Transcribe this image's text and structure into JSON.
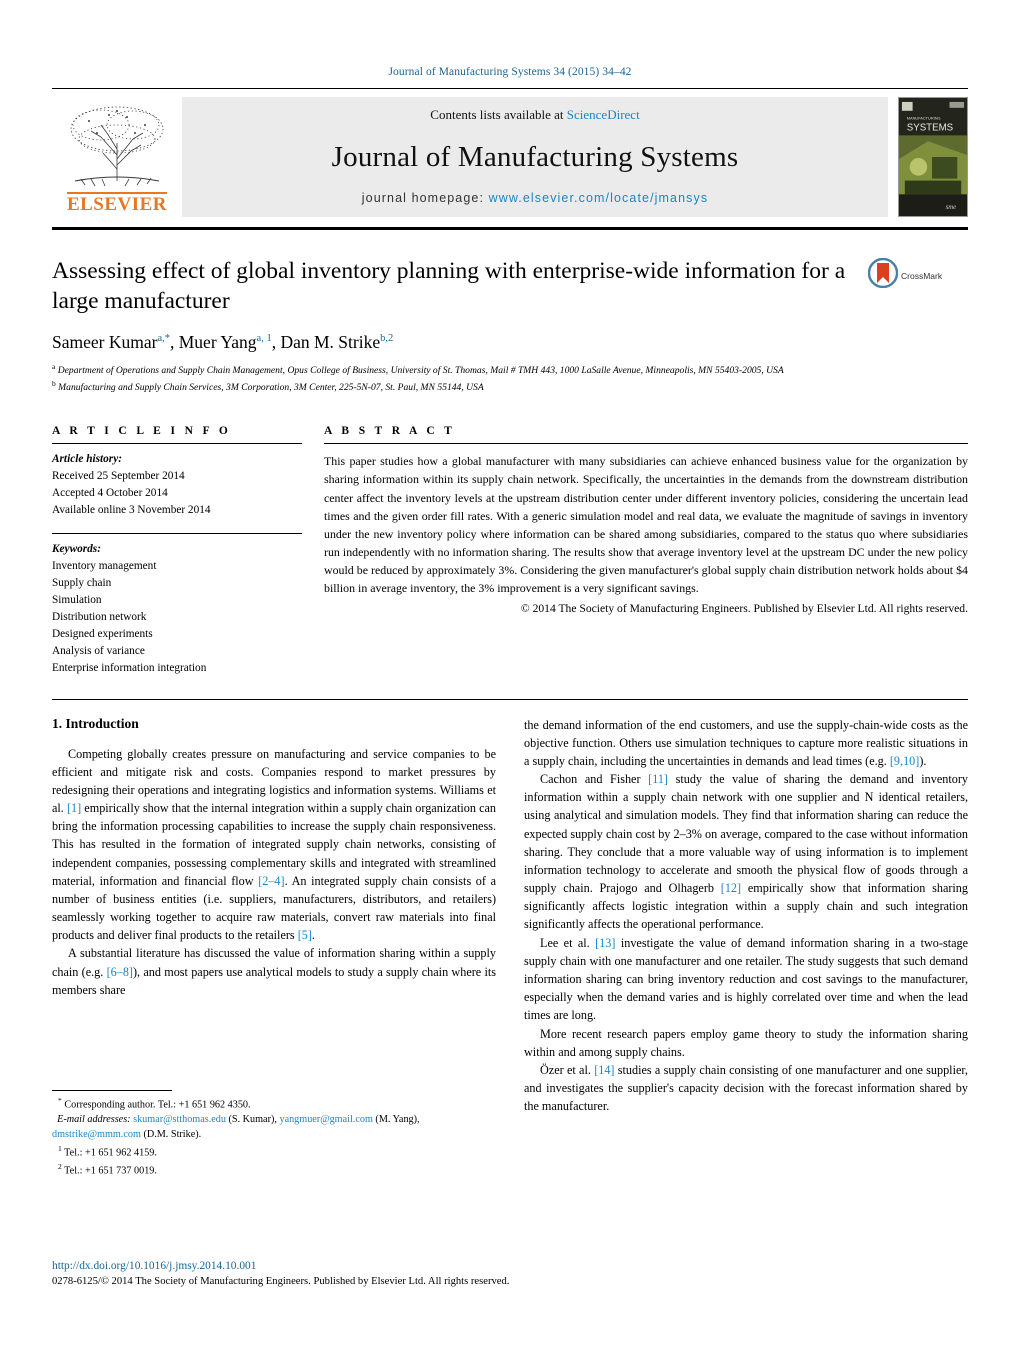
{
  "running_head": "Journal of Manufacturing Systems 34 (2015) 34–42",
  "masthead": {
    "contents_prefix": "Contents lists available at",
    "sciencedirect": "ScienceDirect",
    "journal_name": "Journal of Manufacturing Systems",
    "homepage_prefix": "journal homepage:",
    "homepage_url": "www.elsevier.com/locate/jmansys",
    "publisher": "ELSEVIER",
    "cover_title_small": "JOURNAL OF",
    "cover_title_main": "MANUFACTURING",
    "cover_title_main2": "SYSTEMS"
  },
  "article": {
    "title": "Assessing effect of global inventory planning with enterprise-wide information for a large manufacturer",
    "crossmark_label": "CrossMark",
    "authors_html": "Sameer Kumar<sup>a,*</sup>, Muer Yang<sup>a, 1</sup>, Dan M. Strike<sup>b,2</sup>",
    "affiliation_a": "Department of Operations and Supply Chain Management, Opus College of Business, University of St. Thomas, Mail # TMH 443, 1000 LaSalle Avenue, Minneapolis, MN 55403-2005, USA",
    "affiliation_b": "Manufacturing and Supply Chain Services, 3M Corporation, 3M Center, 225-5N-07, St. Paul, MN 55144, USA"
  },
  "article_info": {
    "heading": "A R T I C L E   I N F O",
    "history_label": "Article history:",
    "history": [
      "Received 25 September 2014",
      "Accepted 4 October 2014",
      "Available online 3 November 2014"
    ],
    "keywords_label": "Keywords:",
    "keywords": [
      "Inventory management",
      "Supply chain",
      "Simulation",
      "Distribution network",
      "Designed experiments",
      "Analysis of variance",
      "Enterprise information integration"
    ]
  },
  "abstract": {
    "heading": "A B S T R A C T",
    "text": "This paper studies how a global manufacturer with many subsidiaries can achieve enhanced business value for the organization by sharing information within its supply chain network. Specifically, the uncertainties in the demands from the downstream distribution center affect the inventory levels at the upstream distribution center under different inventory policies, considering the uncertain lead times and the given order fill rates. With a generic simulation model and real data, we evaluate the magnitude of savings in inventory under the new inventory policy where information can be shared among subsidiaries, compared to the status quo where subsidiaries run independently with no information sharing. The results show that average inventory level at the upstream DC under the new policy would be reduced by approximately 3%. Considering the given manufacturer's global supply chain distribution network holds about $4 billion in average inventory, the 3% improvement is a very significant savings.",
    "copyright": "© 2014 The Society of Manufacturing Engineers. Published by Elsevier Ltd. All rights reserved."
  },
  "body": {
    "section_title": "1.  Introduction",
    "left_paragraphs": [
      "Competing globally creates pressure on manufacturing and service companies to be efficient and mitigate risk and costs. Companies respond to market pressures by redesigning their operations and integrating logistics and information systems. Williams et al. [1] empirically show that the internal integration within a supply chain organization can bring the information processing capabilities to increase the supply chain responsiveness. This has resulted in the formation of integrated supply chain networks, consisting of independent companies, possessing complementary skills and integrated with streamlined material, information and financial flow [2–4]. An integrated supply chain consists of a number of business entities (i.e. suppliers, manufacturers, distributors, and retailers) seamlessly working together to acquire raw materials, convert raw materials into final products and deliver final products to the retailers [5].",
      "A substantial literature has discussed the value of information sharing within a supply chain (e.g. [6–8]), and most papers use analytical models to study a supply chain where its members share"
    ],
    "right_paragraphs": [
      "the demand information of the end customers, and use the supply-chain-wide costs as the objective function. Others use simulation techniques to capture more realistic situations in a supply chain, including the uncertainties in demands and lead times (e.g. [9,10]).",
      "Cachon and Fisher [11] study the value of sharing the demand and inventory information within a supply chain network with one supplier and N identical retailers, using analytical and simulation models. They find that information sharing can reduce the expected supply chain cost by 2–3% on average, compared to the case without information sharing. They conclude that a more valuable way of using information is to implement information technology to accelerate and smooth the physical flow of goods through a supply chain. Prajogo and Olhagerb [12] empirically show that information sharing significantly affects logistic integration within a supply chain and such integration significantly affects the operational performance.",
      "Lee et al. [13] investigate the value of demand information sharing in a two-stage supply chain with one manufacturer and one retailer. The study suggests that such demand information sharing can bring inventory reduction and cost savings to the manufacturer, especially when the demand varies and is highly correlated over time and when the lead times are long.",
      "More recent research papers employ game theory to study the information sharing within and among supply chains.",
      "Özer et al. [14] studies a supply chain consisting of one manufacturer and one supplier, and investigates the supplier's capacity decision with the forecast information shared by the manufacturer."
    ]
  },
  "footnotes": {
    "corresponding": "Corresponding author. Tel.: +1 651 962 4350.",
    "email_label": "E-mail addresses:",
    "emails": [
      {
        "address": "skumar@stthomas.edu",
        "owner": "(S. Kumar)"
      },
      {
        "address": "yangmuer@gmail.com",
        "owner": "(M. Yang)"
      },
      {
        "address": "dmstrike@mmm.com",
        "owner": "(D.M. Strike)"
      }
    ],
    "tel1": "Tel.: +1 651 962 4159.",
    "tel2": "Tel.: +1 651 737 0019."
  },
  "page_footer": {
    "doi": "http://dx.doi.org/10.1016/j.jmsy.2014.10.001",
    "issn_line": "0278-6125/© 2014 The Society of Manufacturing Engineers. Published by Elsevier Ltd. All rights reserved."
  },
  "colors": {
    "link_blue": "#1a86c8",
    "head_blue": "#1a6496",
    "elsevier_orange": "#E87722",
    "band_gray": "#ebebeb"
  }
}
